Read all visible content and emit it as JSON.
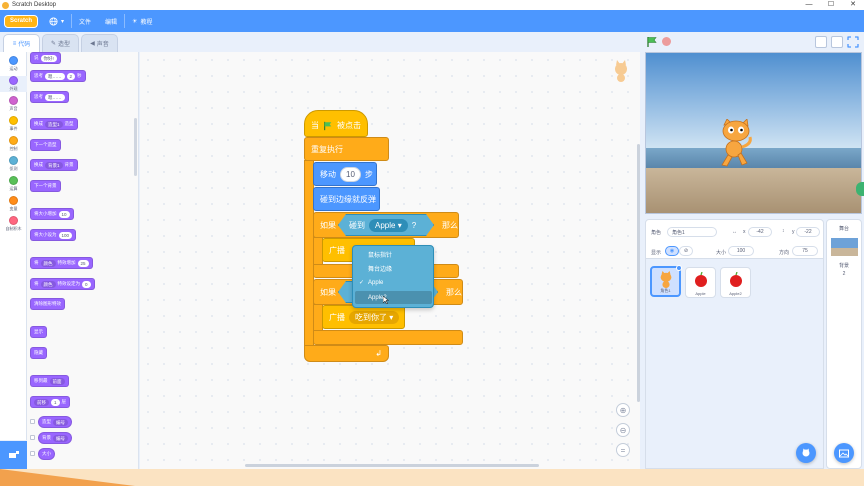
{
  "window": {
    "title": "Scratch Desktop",
    "controls": [
      "—",
      "☐",
      "✕"
    ]
  },
  "menubar": {
    "logo": "Scratch",
    "menu_file": "文件",
    "menu_edit": "编辑",
    "menu_tutorials": "教程"
  },
  "tabs": {
    "code": "代码",
    "costumes": "造型",
    "sounds": "声音"
  },
  "categories": [
    {
      "label": "运动",
      "color": "#4c97ff"
    },
    {
      "label": "外观",
      "color": "#9966ff"
    },
    {
      "label": "声音",
      "color": "#cf63cf"
    },
    {
      "label": "事件",
      "color": "#ffbf00"
    },
    {
      "label": "控制",
      "color": "#ffab19"
    },
    {
      "label": "侦测",
      "color": "#5cb1d6"
    },
    {
      "label": "运算",
      "color": "#59c059"
    },
    {
      "label": "变量",
      "color": "#ff8c1a"
    },
    {
      "label": "自制积木",
      "color": "#ff6680"
    }
  ],
  "palette": {
    "say_for": "说",
    "say_for_value": "你好!",
    "think_for": "思考",
    "think_for_value": "嗯……",
    "think_for_secs": "2",
    "think_for_unit": "秒",
    "think": "思考",
    "think_value": "嗯……",
    "switch_costume": "换成",
    "switch_costume_value": "造型1",
    "switch_costume_suffix": "造型",
    "next_costume": "下一个造型",
    "switch_backdrop": "换成",
    "switch_backdrop_value": "背景1",
    "switch_backdrop_suffix": "背景",
    "next_backdrop": "下一个背景",
    "change_size": "将大小增加",
    "change_size_value": "10",
    "set_size": "将大小设为",
    "set_size_value": "100",
    "change_effect": "将",
    "change_effect_value": "颜色",
    "change_effect_mid": "特效增加",
    "change_effect_amount": "25",
    "set_effect": "将",
    "set_effect_value": "颜色",
    "set_effect_mid": "特效设定为",
    "set_effect_amount": "0",
    "clear_effects": "清除图形特效",
    "show": "显示",
    "hide": "隐藏",
    "go_layer": "移到最",
    "go_layer_value": "前面",
    "change_layer": "",
    "change_layer_dir": "前移",
    "change_layer_value": "1",
    "change_layer_unit": "层",
    "costume_num": "造型",
    "costume_num_value": "编号",
    "backdrop_num": "背景",
    "backdrop_num_value": "编号",
    "size": "大小"
  },
  "script": {
    "when_flag": "当",
    "when_flag_suffix": "被点击",
    "forever": "重复执行",
    "move": "移动",
    "move_steps": "10",
    "move_unit": "步",
    "bounce": "碰到边缘就反弹",
    "if1": "如果",
    "touching": "碰到",
    "touching_value": "Apple",
    "question": "?",
    "then1": "那么",
    "broadcast1": "广播",
    "if2": "如果",
    "then2": "那么",
    "broadcast2": "广播",
    "broadcast2_value": "吃到你了"
  },
  "dropdown": {
    "items": [
      "鼠标指针",
      "舞台边缘",
      "Apple",
      "Apple2"
    ],
    "checked_index": 2,
    "hovered_index": 3
  },
  "sprite_info": {
    "sprite_label": "角色",
    "sprite_name": "角色1",
    "x_label": "x",
    "x_value": "-42",
    "y_label": "y",
    "y_value": "-22",
    "show_label": "显示",
    "size_label": "大小",
    "size_value": "100",
    "direction_label": "方向",
    "direction_value": "75"
  },
  "sprites": [
    {
      "name": "角色1",
      "selected": true
    },
    {
      "name": "Apple",
      "selected": false
    },
    {
      "name": "Apple2",
      "selected": false
    }
  ],
  "backdrop_panel": {
    "title": "舞台",
    "label": "背景",
    "count": "2"
  }
}
